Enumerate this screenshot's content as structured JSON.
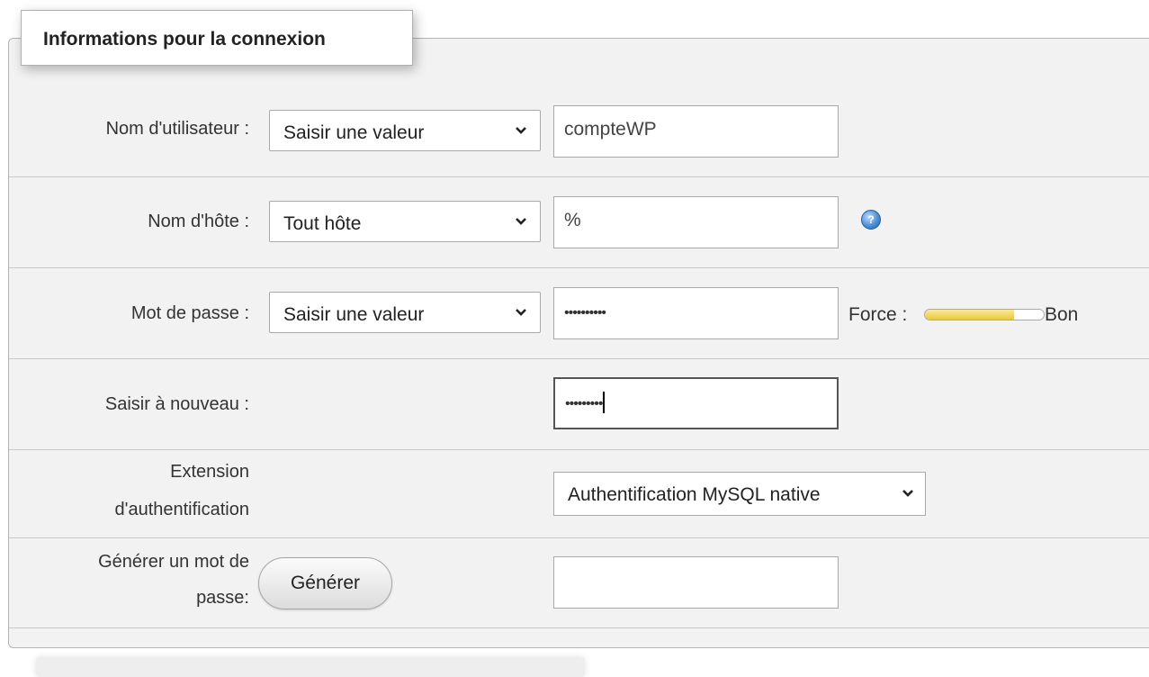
{
  "legend": "Informations pour la connexion",
  "rows": {
    "username": {
      "label": "Nom d'utilisateur :",
      "select": "Saisir une valeur",
      "value": "compteWP"
    },
    "hostname": {
      "label": "Nom d'hôte :",
      "select": "Tout hôte",
      "value": "%",
      "help_icon": "help-icon"
    },
    "password": {
      "label": "Mot de passe :",
      "select": "Saisir une valeur",
      "value": "••••••••••",
      "strength_label": "Force :",
      "strength_text": "Bon",
      "strength_level": 0.75
    },
    "retype": {
      "label": "Saisir à nouveau :",
      "value": "•••••••••"
    },
    "auth_plugin": {
      "label_line1": "Extension",
      "label_line2": "d'authentification",
      "select": "Authentification MySQL native"
    },
    "generate": {
      "label_line1": "Générer un mot de",
      "label_line2": "passe:",
      "button": "Générer",
      "value": ""
    }
  },
  "colors": {
    "panel_bg": "#f2f2f2",
    "meter_fill": "#e9c93a"
  }
}
